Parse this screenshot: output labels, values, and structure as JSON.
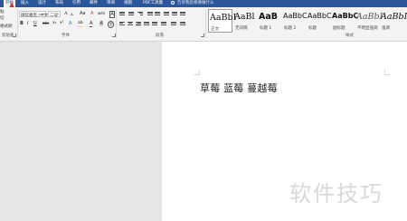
{
  "tabs": [
    {
      "label": "开始",
      "active": true
    },
    {
      "label": "插入"
    },
    {
      "label": "设计"
    },
    {
      "label": "布局"
    },
    {
      "label": "引用"
    },
    {
      "label": "邮件"
    },
    {
      "label": "审阅"
    },
    {
      "label": "视图"
    },
    {
      "label": "PDF工具集"
    }
  ],
  "tell_me": "告诉我您想要做什么",
  "clipboard": {
    "label": "剪贴板",
    "paste_frag": "贴",
    "cut_frag": "切",
    "painter_frag": "格式刷"
  },
  "font": {
    "label": "字体",
    "name": "微软雅黑 (中文",
    "size": "二号",
    "grow": "A",
    "shrink": "A",
    "case": "Aa",
    "clear": "A",
    "phonetic": "wén",
    "border_char": "A",
    "bold": "B",
    "italic": "I",
    "underline": "U",
    "strike": "abc",
    "sub": "x₂",
    "super": "x²",
    "effects": "A",
    "highlight": "ab",
    "color": "A",
    "shading": "A",
    "enclose": "字"
  },
  "paragraph": {
    "label": "段落"
  },
  "styles": {
    "label": "样式",
    "items": [
      {
        "preview": "AaBbI",
        "name": "正文"
      },
      {
        "preview": "AaBl",
        "name": "无间隔"
      },
      {
        "preview": "AaB",
        "name": "标题 1"
      },
      {
        "preview": "AaBbC",
        "name": "标题 2"
      },
      {
        "preview": "AaBbC",
        "name": "标题"
      },
      {
        "preview": "AaBbC",
        "name": "副标题"
      },
      {
        "preview": "AaBbI",
        "name": "不明显强调"
      },
      {
        "preview": "AaBbI",
        "name": "强调"
      }
    ]
  },
  "document": {
    "text": "草莓  蓝莓  蔓越莓"
  },
  "watermark": "软件技巧",
  "colors": {
    "brand": "#2b579a",
    "ribbon": "#f3f3f3",
    "highlight": "#ffff00",
    "font_color": "#ff0000",
    "red_marker": "#d9302c"
  }
}
